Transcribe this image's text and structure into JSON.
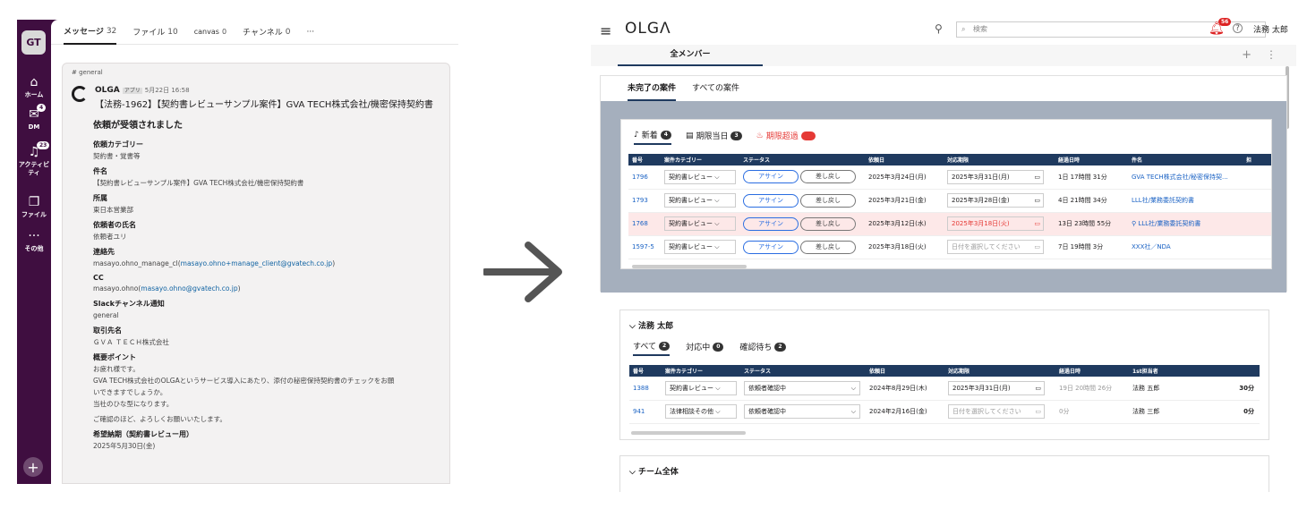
{
  "slack": {
    "workspace": "GT",
    "rail": [
      {
        "label": "ホーム",
        "icon": "home-icon"
      },
      {
        "label": "DM",
        "icon": "dm-icon",
        "badge": "4"
      },
      {
        "label": "アクティビティ",
        "icon": "activity-icon",
        "badge": "23"
      },
      {
        "label": "ファイル",
        "icon": "file-icon"
      },
      {
        "label": "その他",
        "icon": "more-icon"
      }
    ],
    "tabs": [
      {
        "label": "メッセージ",
        "count": "32"
      },
      {
        "label": "ファイル",
        "count": "10"
      },
      {
        "label": "canvas",
        "count": "0"
      },
      {
        "label": "チャンネル",
        "count": "0"
      },
      {
        "label": "···",
        "count": ""
      }
    ],
    "message": {
      "channel": "# general",
      "sender": "OLGA",
      "app_tag": "アプリ",
      "time": "5月22日 16:58",
      "title": "【法務-1962】【契約書レビューサンプル案件】GVA TECH株式会社/機密保持契約書",
      "headline": "依頼が受領されました",
      "fields": [
        {
          "label": "依頼カテゴリー",
          "value": "契約書・覚書等"
        },
        {
          "label": "件名",
          "value": "【契約書レビューサンプル案件】GVA TECH株式会社/機密保持契約書"
        },
        {
          "label": "所属",
          "value": "東日本営業部"
        },
        {
          "label": "依頼者の氏名",
          "value": "依頼者ユリ"
        },
        {
          "label": "連絡先",
          "value": "masayo.ohno_manage_cl(",
          "link": "masayo.ohno+manage_client@gvatech.co.jp",
          "after": ")"
        },
        {
          "label": "CC",
          "value": "masayo.ohno(",
          "link": "masayo.ohno@gvatech.co.jp",
          "after": ")"
        },
        {
          "label": "Slackチャンネル通知",
          "value": "general"
        },
        {
          "label": "取引先名",
          "value": "ＧＶＡ ＴＥＣＨ株式会社"
        }
      ],
      "summary_label": "概要ポイント",
      "summary_lines": [
        "お疲れ様です。",
        "GVA TECH株式会社のOLGAというサービス導入にあたり、添付の秘密保持契約書のチェックをお願",
        "いできますでしょうか。",
        "当社のひな型になります。",
        "ご確認のほど、よろしくお願いいたします。"
      ],
      "due_label": "希望納期（契約書レビュー用）",
      "due_value": "2025年5月30日(金)"
    }
  },
  "olga": {
    "logo": "OLGΛ",
    "search_placeholder": "検索",
    "notif_count": "56",
    "user_name": "法務 太郎",
    "member_tab": "全メンバー",
    "case_tabs": [
      "未完了の案件",
      "すべての案件"
    ],
    "sub_tabs": [
      {
        "label": "新着",
        "count": "4",
        "icon": "bell-icon"
      },
      {
        "label": "期限当日",
        "count": "3",
        "icon": "calendar-icon"
      },
      {
        "label": "期限超過",
        "count": "22",
        "icon": "fire-icon"
      }
    ],
    "table1": {
      "headers": [
        "番号",
        "案件カテゴリー",
        "ステータス",
        "",
        "依頼日",
        "対応期限",
        "経過日時",
        "件名",
        "担"
      ],
      "rows": [
        {
          "no": "1796",
          "cat": "契約書レビュー",
          "assign": "アサイン",
          "back": "差し戻し",
          "req": "2025年3月24日(月)",
          "due": "2025年3月31日(月)",
          "elapsed": "1日 17時間 31分",
          "subject": "GVA TECH株式会社/秘密保持契..."
        },
        {
          "no": "1793",
          "cat": "契約書レビュー",
          "assign": "アサイン",
          "back": "差し戻し",
          "req": "2025年3月21日(金)",
          "due": "2025年3月28日(金)",
          "elapsed": "4日 21時間 34分",
          "subject": "LLL社/業務委託契約書"
        },
        {
          "no": "1768",
          "cat": "契約書レビュー",
          "assign": "アサイン",
          "back": "差し戻し",
          "req": "2025年3月12日(水)",
          "due": "2025年3月18日(火)",
          "elapsed": "13日 23時間 55分",
          "subject": "LLL社/業務委託契約書"
        },
        {
          "no": "1597-5",
          "cat": "契約書レビュー",
          "assign": "アサイン",
          "back": "差し戻し",
          "req": "2025年3月18日(火)",
          "due": "日付を選択してください",
          "elapsed": "7日 19時間 3分",
          "subject": "XXX社／NDA"
        }
      ]
    },
    "panel1": {
      "title": "法務 太郎",
      "tabs": [
        {
          "label": "すべて",
          "count": "2"
        },
        {
          "label": "対応中",
          "count": "0"
        },
        {
          "label": "確認待ち",
          "count": "2"
        }
      ],
      "headers": [
        "番号",
        "案件カテゴリー",
        "ステータス",
        "依頼日",
        "対応期限",
        "経過日時",
        "1st担当者"
      ],
      "rows": [
        {
          "no": "1388",
          "cat": "契約書レビュー",
          "status": "依頼者確認中",
          "req": "2024年8月29日(木)",
          "due": "2025年3月31日(月)",
          "elapsed": "19日 20時間 26分",
          "owner": "法務 五郎",
          "time": "30分"
        },
        {
          "no": "941",
          "cat": "法律相談その他",
          "status": "依頼者確認中",
          "req": "2024年2月16日(金)",
          "due": "日付を選択してください",
          "elapsed": "0分",
          "owner": "法務 三郎",
          "time": "0分"
        }
      ]
    },
    "panel2": {
      "title": "チーム全体"
    }
  }
}
